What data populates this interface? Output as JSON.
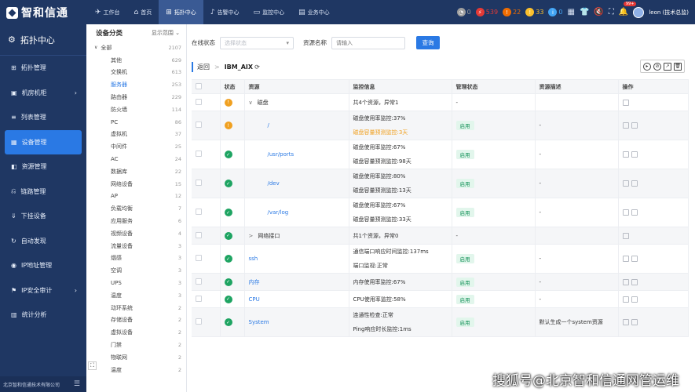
{
  "topbar": {
    "brand": "智和信通",
    "nav": [
      {
        "label": "工作台",
        "icon": "rocket-icon"
      },
      {
        "label": "首页",
        "icon": "home-icon"
      },
      {
        "label": "拓扑中心",
        "icon": "topology-icon",
        "active": true
      },
      {
        "label": "告警中心",
        "icon": "bell-icon"
      },
      {
        "label": "监控中心",
        "icon": "monitor-icon"
      },
      {
        "label": "业务中心",
        "icon": "business-icon"
      }
    ],
    "stats": [
      {
        "value": "0",
        "color": "#9e9e9e"
      },
      {
        "value": "539",
        "color": "#e53935"
      },
      {
        "value": "22",
        "color": "#ef6c00"
      },
      {
        "value": "33",
        "color": "#fbc02d"
      },
      {
        "value": "0",
        "color": "#42a5f5"
      }
    ],
    "notify_badge": "99+",
    "user": "leon (技术总监)"
  },
  "sidebar": {
    "title": "拓扑中心",
    "items": [
      {
        "label": "拓扑管理",
        "icon": "topology-icon"
      },
      {
        "label": "机房机柜",
        "icon": "server-icon",
        "chevron": true
      },
      {
        "label": "列表管理",
        "icon": "list-icon"
      },
      {
        "label": "设备管理",
        "icon": "device-icon",
        "active": true
      },
      {
        "label": "资源管理",
        "icon": "resource-icon"
      },
      {
        "label": "链路管理",
        "icon": "link-icon"
      },
      {
        "label": "下挂设备",
        "icon": "hang-icon"
      },
      {
        "label": "自动发现",
        "icon": "discover-icon"
      },
      {
        "label": "IP地址管理",
        "icon": "ip-icon"
      },
      {
        "label": "IP安全审计",
        "icon": "audit-icon",
        "chevron": true
      },
      {
        "label": "统计分析",
        "icon": "stats-icon"
      }
    ],
    "footer": "北京智和信通技术有限公司"
  },
  "categories": {
    "title": "设备分类",
    "scope": "显示范围",
    "root": {
      "label": "全部",
      "count": "2107"
    },
    "items": [
      {
        "label": "其他",
        "count": "629"
      },
      {
        "label": "交换机",
        "count": "613"
      },
      {
        "label": "服务器",
        "count": "253",
        "selected": true
      },
      {
        "label": "路由器",
        "count": "229"
      },
      {
        "label": "防火墙",
        "count": "114"
      },
      {
        "label": "PC",
        "count": "86"
      },
      {
        "label": "虚拟机",
        "count": "37"
      },
      {
        "label": "中间件",
        "count": "25"
      },
      {
        "label": "AC",
        "count": "24"
      },
      {
        "label": "数据库",
        "count": "22"
      },
      {
        "label": "网络设备",
        "count": "15"
      },
      {
        "label": "AP",
        "count": "12"
      },
      {
        "label": "负载均衡",
        "count": "7"
      },
      {
        "label": "应用服务",
        "count": "6"
      },
      {
        "label": "视频设备",
        "count": "4"
      },
      {
        "label": "流量设备",
        "count": "3"
      },
      {
        "label": "烟感",
        "count": "3"
      },
      {
        "label": "空调",
        "count": "3"
      },
      {
        "label": "UPS",
        "count": "3"
      },
      {
        "label": "温度",
        "count": "3"
      },
      {
        "label": "动环系统",
        "count": "2"
      },
      {
        "label": "存储设备",
        "count": "2"
      },
      {
        "label": "虚拟设备",
        "count": "2"
      },
      {
        "label": "门禁",
        "count": "2"
      },
      {
        "label": "物联网",
        "count": "2"
      },
      {
        "label": "温度",
        "count": "2"
      }
    ]
  },
  "filters": {
    "status_label": "在线状态",
    "status_placeholder": "选择状态",
    "name_label": "资源名称",
    "name_placeholder": "请输入",
    "query": "查询"
  },
  "breadcrumb": {
    "back": "返回",
    "sep": ">",
    "current": "IBM_AIX"
  },
  "table": {
    "headers": [
      "",
      "状态",
      "资源",
      "监控信息",
      "管理状态",
      "资源描述",
      "操作"
    ],
    "rows": [
      {
        "status": "warn",
        "expand": "∨",
        "name": "磁盘",
        "link": false,
        "monitor": [
          {
            "t": "共4个资源，异常1"
          }
        ],
        "manage": "-",
        "desc": "",
        "ops": 1
      },
      {
        "status": "warn",
        "name": "/",
        "link": true,
        "monitor": [
          {
            "t": "磁盘使用率监控:37%"
          },
          {
            "t": "磁盘容量预测监控:3天",
            "warn": true
          }
        ],
        "manage": "启用",
        "desc": "-",
        "ops": 2
      },
      {
        "status": "ok",
        "name": "/usr/ports",
        "link": true,
        "monitor": [
          {
            "t": "磁盘使用率监控:67%"
          },
          {
            "t": "磁盘容量预测监控:98天"
          }
        ],
        "manage": "启用",
        "desc": "-",
        "ops": 2
      },
      {
        "status": "ok",
        "name": "/dev",
        "link": true,
        "monitor": [
          {
            "t": "磁盘使用率监控:80%"
          },
          {
            "t": "磁盘容量预测监控:13天"
          }
        ],
        "manage": "启用",
        "desc": "-",
        "ops": 2
      },
      {
        "status": "ok",
        "name": "/var/log",
        "link": true,
        "monitor": [
          {
            "t": "磁盘使用率监控:67%"
          },
          {
            "t": "磁盘容量预测监控:33天"
          }
        ],
        "manage": "启用",
        "desc": "-",
        "ops": 2
      },
      {
        "status": "ok",
        "expand": ">",
        "name": "网络接口",
        "link": false,
        "monitor": [
          {
            "t": "共1个资源，异常0"
          }
        ],
        "manage": "-",
        "desc": "",
        "ops": 1
      },
      {
        "status": "ok",
        "name": "ssh",
        "link": true,
        "top": true,
        "monitor": [
          {
            "t": "通信端口响应时间监控:137ms"
          },
          {
            "t": "端口监视:正常"
          }
        ],
        "manage": "启用",
        "desc": "-",
        "ops": 2
      },
      {
        "status": "ok",
        "name": "内存",
        "link": true,
        "top": true,
        "monitor": [
          {
            "t": "内存使用率监控:67%"
          }
        ],
        "manage": "启用",
        "desc": "-",
        "ops": 2
      },
      {
        "status": "ok",
        "name": "CPU",
        "link": true,
        "top": true,
        "monitor": [
          {
            "t": "CPU使用率监控:58%"
          }
        ],
        "manage": "启用",
        "desc": "-",
        "ops": 2
      },
      {
        "status": "ok",
        "name": "System",
        "link": true,
        "top": true,
        "monitor": [
          {
            "t": "连通性检查:正常"
          },
          {
            "t": "Ping响应时长监控:1ms"
          }
        ],
        "manage": "启用",
        "desc": "默认生成一个system资源",
        "ops": 2
      }
    ]
  },
  "watermark": "搜狐号@北京智和信通网管运维"
}
